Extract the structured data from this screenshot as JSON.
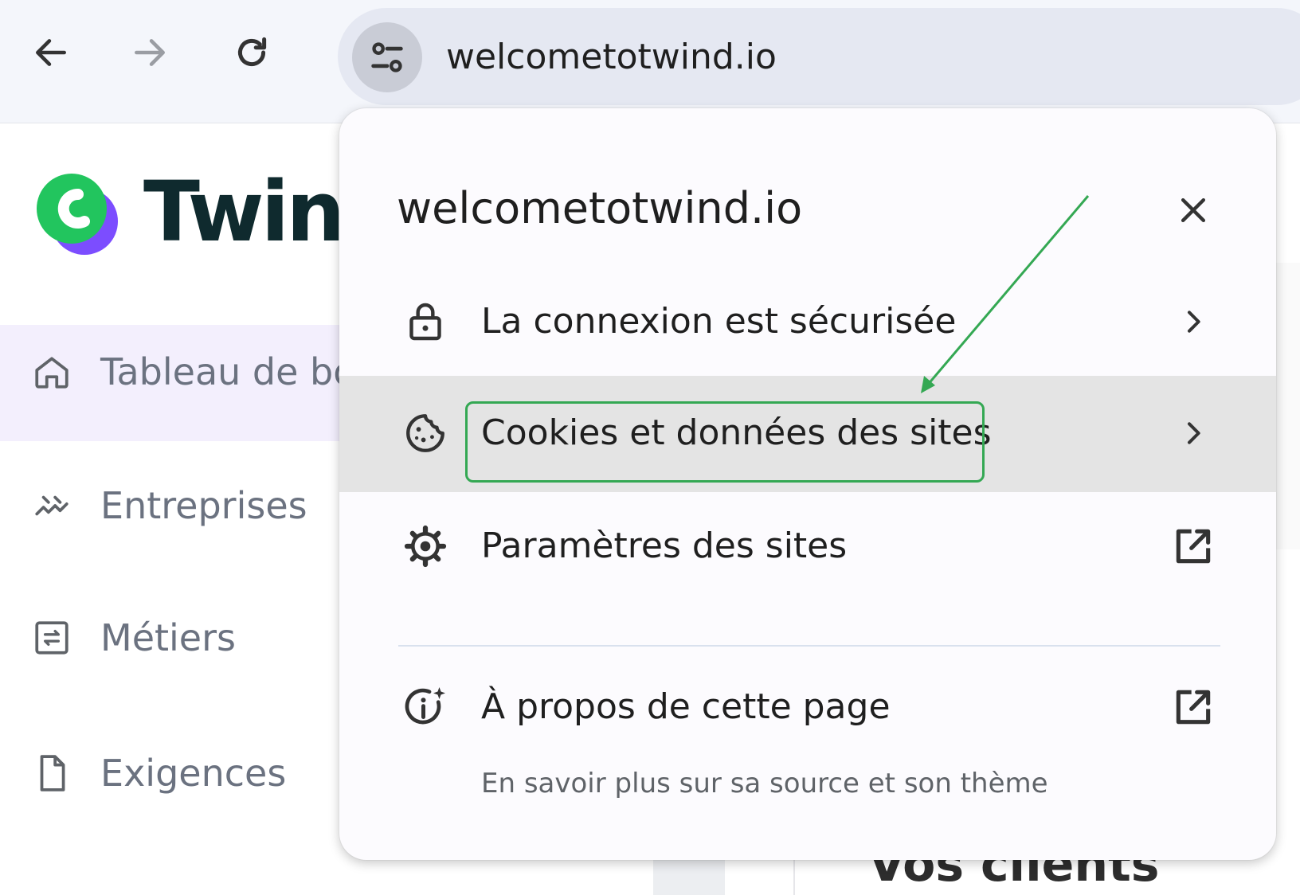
{
  "browser": {
    "url": "welcometotwind.io",
    "back_icon": "arrow-left-icon",
    "forward_icon": "arrow-right-icon",
    "reload_icon": "reload-icon",
    "site_info_icon": "tune-icon"
  },
  "app": {
    "logo_text": "Twind",
    "brand_colors": {
      "green": "#22c55e",
      "purple": "#7c4dff",
      "text": "#0f2a2e"
    },
    "nav": [
      {
        "label": "Tableau de bord",
        "icon": "home-icon",
        "active": true
      },
      {
        "label": "Entreprises",
        "icon": "handshake-icon"
      },
      {
        "label": "Métiers",
        "icon": "swap-box-icon"
      },
      {
        "label": "Exigences",
        "icon": "document-icon"
      }
    ],
    "bottom_text": "Vos clients"
  },
  "popup": {
    "title": "welcometotwind.io",
    "close_icon": "close-icon",
    "items": [
      {
        "label": "La connexion est sécurisée",
        "icon": "lock-icon",
        "trailing_icon": "chevron-right-icon"
      },
      {
        "label": "Cookies et données des sites",
        "icon": "cookie-icon",
        "trailing_icon": "chevron-right-icon",
        "highlighted": true
      },
      {
        "label": "Paramètres des sites",
        "icon": "gear-icon",
        "trailing_icon": "open-external-icon"
      },
      {
        "label": "À propos de cette page",
        "sublabel": "En savoir plus sur sa source et son thème",
        "icon": "info-sparkle-icon",
        "trailing_icon": "open-external-icon"
      }
    ]
  },
  "annotation": {
    "color": "#34a853"
  }
}
